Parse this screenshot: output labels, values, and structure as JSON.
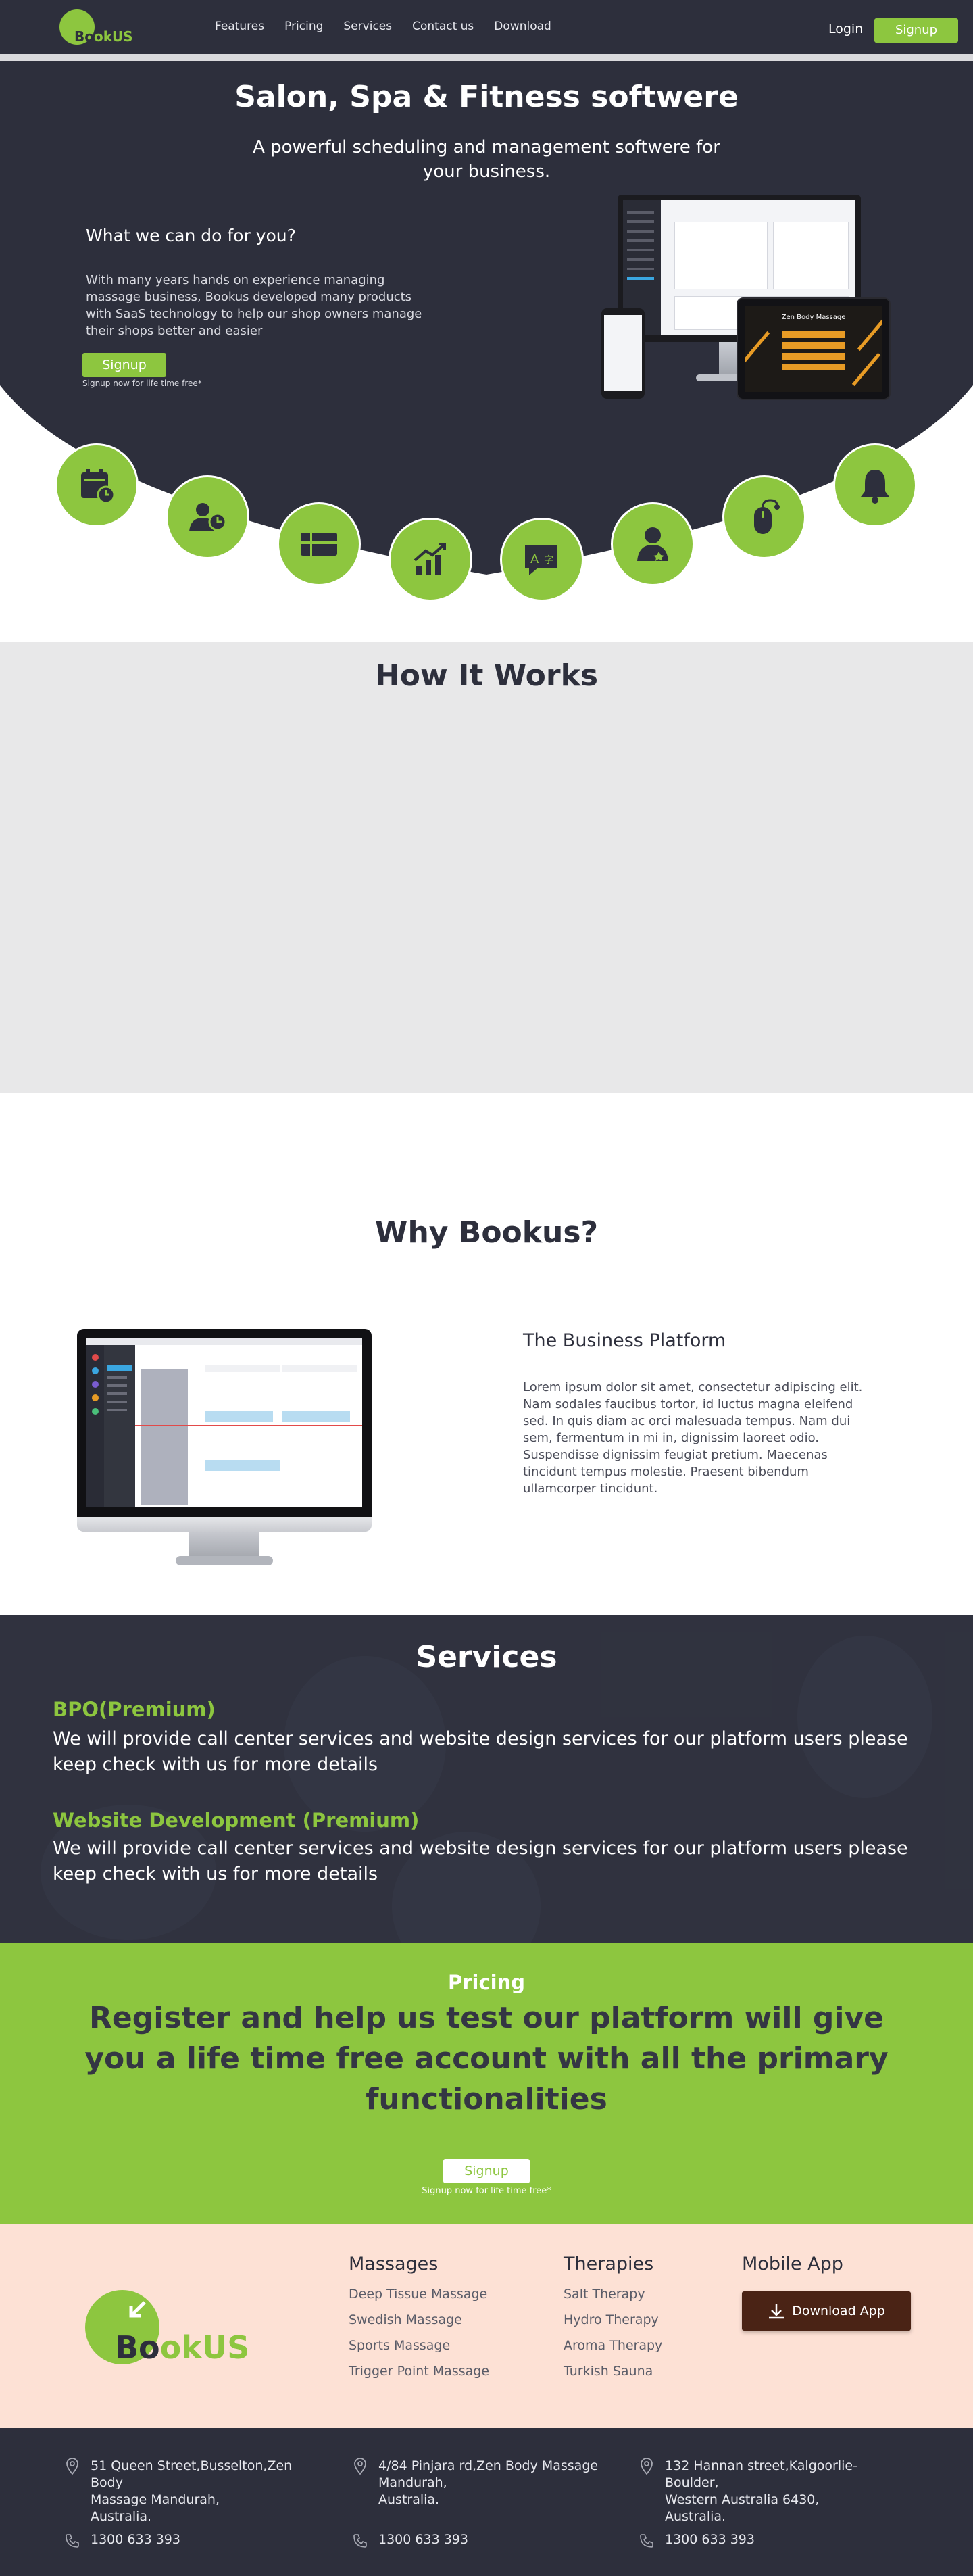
{
  "nav": {
    "logo_text_a": "Bo",
    "logo_text_b": "okUS",
    "links": [
      "Features",
      "Pricing",
      "Services",
      "Contact us",
      "Download"
    ],
    "login": "Login",
    "signup": "Signup"
  },
  "hero": {
    "title": "Salon, Spa & Fitness softwere",
    "subtitle": "A powerful scheduling and management softwere for your business.",
    "question": "What we can do for you?",
    "description": "With many years hands on experience managing massage business, Bookus developed many products with SaaS technology to help our shop owners manage their shops better and easier",
    "signup": "Signup",
    "note": "Signup now for life time free*",
    "tablet_title": "Zen Body Massage"
  },
  "features": {
    "icons": [
      "calendar-clock-icon",
      "user-clock-icon",
      "ticket-icon",
      "growth-chart-icon",
      "translate-icon",
      "user-star-icon",
      "mouse-icon",
      "bell-icon"
    ]
  },
  "how": {
    "title": "How It Works"
  },
  "why": {
    "title": "Why Bookus?",
    "heading": "The Business Platform",
    "text": "Lorem ipsum dolor sit amet, consectetur adipiscing elit. Nam sodales faucibus tortor, id luctus magna eleifend sed. In quis diam ac orci malesuada tempus. Nam dui sem, fermentum in mi in, dignissim laoreet odio. Suspendisse dignissim feugiat pretium. Maecenas tincidunt tempus molestie. Praesent bibendum ullamcorper tincidunt."
  },
  "services": {
    "title": "Services",
    "items": [
      {
        "title": "BPO(Premium)",
        "text": "We will provide call center services and website design services for our platform users please keep check with us for more details"
      },
      {
        "title": "Website Development (Premium)",
        "text": "We will provide call center services and website design services for our platform users please keep check with us for more details"
      }
    ]
  },
  "pricing": {
    "label": "Pricing",
    "message": "Register and help us test our platform will give you a life time free account with all the primary functionalities",
    "signup": "Signup",
    "note": "Signup now for life time free*"
  },
  "footer": {
    "logo_text_a": "Bo",
    "logo_text_b": "okUS",
    "massages": {
      "heading": "Massages",
      "items": [
        "Deep Tissue Massage",
        "Swedish Massage",
        "Sports Massage",
        "Trigger Point Massage"
      ]
    },
    "therapies": {
      "heading": "Therapies",
      "items": [
        "Salt Therapy",
        "Hydro Therapy",
        "Aroma Therapy",
        "Turkish Sauna"
      ]
    },
    "app": {
      "heading": "Mobile App",
      "button": "Download App"
    },
    "addresses": [
      {
        "line1": "51 Queen Street,Busselton,Zen Body",
        "line2": "Massage Mandurah,",
        "line3": "Australia.",
        "phone": "1300 633 393"
      },
      {
        "line1": "4/84 Pinjara rd,Zen Body Massage",
        "line2": "Mandurah,",
        "line3": "Australia.",
        "phone": "1300 633 393"
      },
      {
        "line1": "132 Hannan street,Kalgoorlie- Boulder,",
        "line2": "Western Australia 6430,",
        "line3": "Australia.",
        "phone": "1300 633 393"
      }
    ]
  },
  "colors": {
    "brand_green": "#8dc63f",
    "dark": "#2d2f3c",
    "peach": "#fde1d5",
    "download_brown": "#4a2315"
  }
}
